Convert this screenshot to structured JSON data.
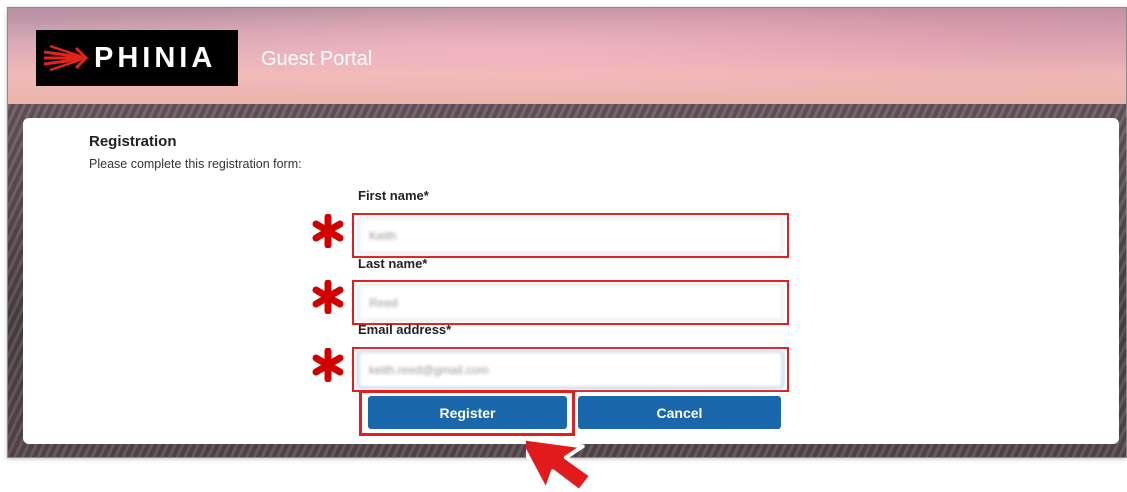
{
  "header": {
    "logo_text": "PHINIA",
    "portal_title": "Guest Portal"
  },
  "form": {
    "title": "Registration",
    "subtitle": "Please complete this registration form:",
    "fields": [
      {
        "label": "First name*",
        "value": "Keith"
      },
      {
        "label": "Last name*",
        "value": "Reed"
      },
      {
        "label": "Email address*",
        "value": "keith.reed@gmail.com"
      }
    ],
    "register_label": "Register",
    "cancel_label": "Cancel"
  },
  "colors": {
    "button": "#1a67ab",
    "highlight": "#e02020"
  },
  "icons": {
    "required": "asterisk-icon",
    "pointer": "arrow-cursor-icon",
    "logo": "phinia-logo-mark"
  }
}
